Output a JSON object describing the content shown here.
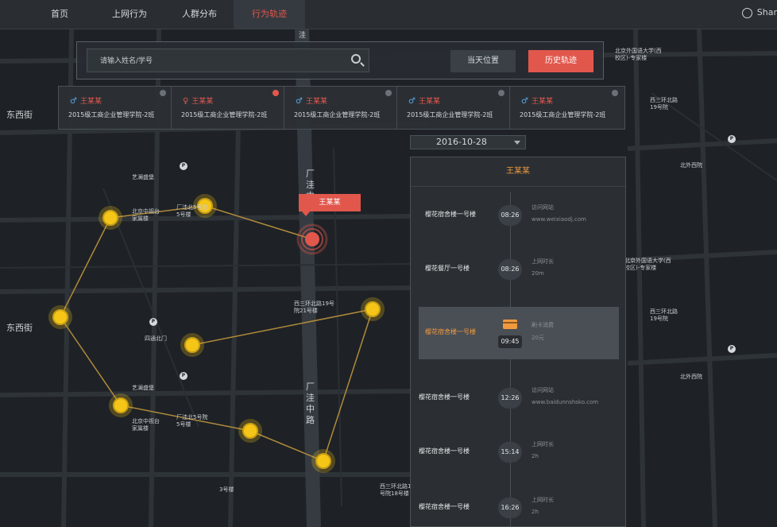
{
  "nav": {
    "items": [
      {
        "label": "首页"
      },
      {
        "label": "上网行为"
      },
      {
        "label": "人群分布"
      },
      {
        "label": "行为轨迹"
      }
    ],
    "active_index": 3,
    "user": "Shar"
  },
  "search": {
    "placeholder": "请输入姓名/学号",
    "btn_current": "当天位置",
    "btn_history": "历史轨迹"
  },
  "cards": [
    {
      "gender": "♂",
      "name": "王某某",
      "class": "2015级工商企业管理学院-2班",
      "close_color": "#6b7178"
    },
    {
      "gender": "♀",
      "name": "王某某",
      "class": "2015级工商企业管理学院-2班",
      "close_color": "#e2574c"
    },
    {
      "gender": "♂",
      "name": "王某某",
      "class": "2015级工商企业管理学院-2班",
      "close_color": "#6b7178"
    },
    {
      "gender": "♂",
      "name": "王某某",
      "class": "2015级工商企业管理学院-2班",
      "close_color": "#6b7178"
    },
    {
      "gender": "♂",
      "name": "王某某",
      "class": "2015级工商企业管理学院-2班",
      "close_color": "#6b7178"
    }
  ],
  "date": "2016-10-28",
  "timeline": {
    "title": "王某某",
    "entries": [
      {
        "location": "樱花宿舍楼一号楼",
        "time": "08:26",
        "activity": "访问网站",
        "detail": "www.weixiaodj.com"
      },
      {
        "location": "樱花餐厅一号楼",
        "time": "08:26",
        "activity": "上网时长",
        "detail": "20m"
      },
      {
        "location": "樱花宿舍楼一号楼",
        "time": "09:45",
        "activity": "刷卡消费",
        "detail": "20元"
      },
      {
        "location": "樱花宿舍楼一号楼",
        "time": "12:26",
        "activity": "访问网站",
        "detail": "www.baidunnshsko.com"
      },
      {
        "location": "樱花宿舍楼一号楼",
        "time": "15:14",
        "activity": "上网时长",
        "detail": "2h"
      },
      {
        "location": "樱花宿舍楼一号楼",
        "time": "16:26",
        "activity": "上网时长",
        "detail": "2h"
      }
    ]
  },
  "map": {
    "popup_name": "王某某",
    "roads": {
      "left1": "东西街",
      "left2": "东西街",
      "main1": "厂洼中路",
      "main2": "厂洼中路",
      "top": "洼"
    },
    "labels": {
      "l1": "艺澜盛堡",
      "l2": "北京中视台家属楼",
      "l3": "厂洼北5号院5号楼",
      "l4": "西三环北路19号院21号楼",
      "l5": "四通北门",
      "l6": "艺澜盛堡",
      "l7": "北京中视台家属楼",
      "l8": "厂洼北5号院5号楼",
      "l9": "3号楼",
      "l10": "西三环北路19号院18号楼",
      "r1": "北京外国语大学(西校区)-专家楼",
      "r2": "西三环北路19号院",
      "r3": "北外西院",
      "r4": "北京外国语大学(西校区)-专家楼",
      "r5": "西三环北路19号院",
      "r6": "北外西院"
    }
  },
  "colors": {
    "accent": "#e2574c",
    "orange": "#f09a3e",
    "node": "#f5c518",
    "path": "#b08a3a"
  }
}
